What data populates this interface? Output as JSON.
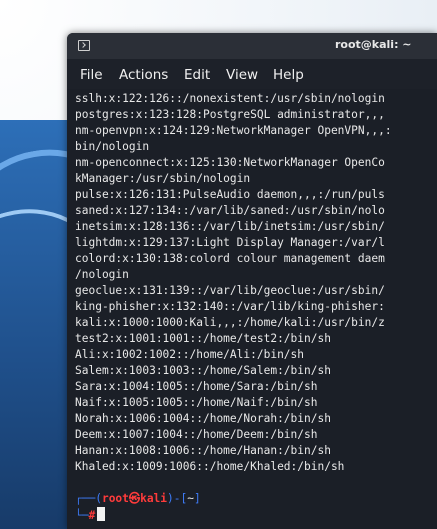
{
  "window": {
    "title": "root@kali: ~",
    "icon": "terminal-window-icon"
  },
  "menubar": [
    "File",
    "Actions",
    "Edit",
    "View",
    "Help"
  ],
  "terminal": {
    "lines": [
      "sslh:x:122:126::/nonexistent:/usr/sbin/nologin",
      "postgres:x:123:128:PostgreSQL administrator,,,",
      "nm-openvpn:x:124:129:NetworkManager OpenVPN,,,:",
      "bin/nologin",
      "nm-openconnect:x:125:130:NetworkManager OpenCo",
      "kManager:/usr/sbin/nologin",
      "pulse:x:126:131:PulseAudio daemon,,,:/run/puls",
      "saned:x:127:134::/var/lib/saned:/usr/sbin/nolo",
      "inetsim:x:128:136::/var/lib/inetsim:/usr/sbin/",
      "lightdm:x:129:137:Light Display Manager:/var/l",
      "colord:x:130:138:colord colour management daem",
      "/nologin",
      "geoclue:x:131:139::/var/lib/geoclue:/usr/sbin/",
      "king-phisher:x:132:140::/var/lib/king-phisher:",
      "kali:x:1000:1000:Kali,,,:/home/kali:/usr/bin/z",
      "test2:x:1001:1001::/home/test2:/bin/sh",
      "Ali:x:1002:1002::/home/Ali:/bin/sh",
      "Salem:x:1003:1003::/home/Salem:/bin/sh",
      "Sara:x:1004:1005::/home/Sara:/bin/sh",
      "Naif:x:1005:1005::/home/Naif:/bin/sh",
      "Norah:x:1006:1004::/home/Norah:/bin/sh",
      "Deem:x:1007:1004::/home/Deem:/bin/sh",
      "Hanan:x:1008:1006::/home/Hanan:/bin/sh",
      "Khaled:x:1009:1006::/home/Khaled:/bin/sh"
    ],
    "prompt": {
      "corner_top": "┌──(",
      "user_host": "root㉿kali",
      "sep": ")-[",
      "path": "~",
      "close": "]",
      "corner_bottom": "└─",
      "hash": "#"
    }
  },
  "colors": {
    "terminal_bg": "#1b1f27",
    "titlebar_bg": "#2b2f37",
    "prompt_blue": "#3d7bf7",
    "prompt_red": "#ff3b3b",
    "text": "#e8e8e8"
  }
}
